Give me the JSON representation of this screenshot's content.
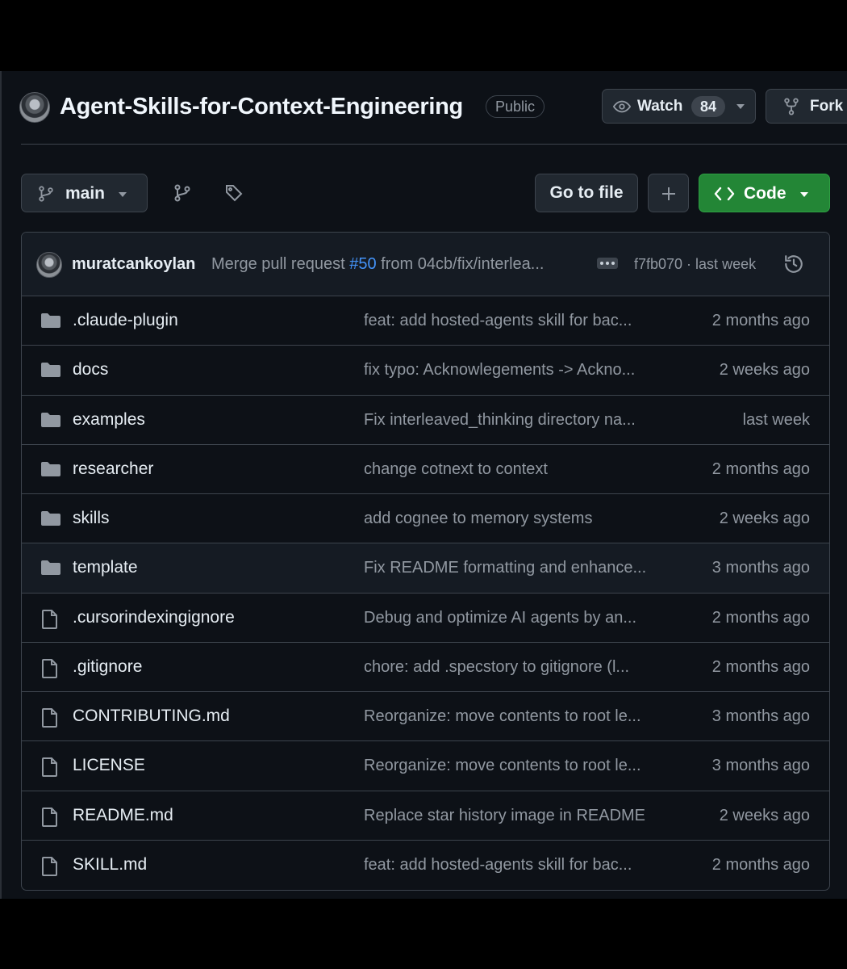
{
  "repo": {
    "name": "Agent-Skills-for-Context-Engineering",
    "visibility": "Public"
  },
  "actions": {
    "watch_label": "Watch",
    "watch_count": "84",
    "fork_label": "Fork"
  },
  "toolbar": {
    "branch": "main",
    "goto_file": "Go to file",
    "code_label": "Code"
  },
  "latest_commit": {
    "author": "muratcankoylan",
    "message_prefix": "Merge pull request ",
    "pr": "#50",
    "message_suffix": " from 04cb/fix/interlea...",
    "meta": "f7fb070 · last week"
  },
  "files": [
    {
      "type": "folder",
      "name": ".claude-plugin",
      "message": "feat: add hosted-agents skill for bac...",
      "date": "2 months ago"
    },
    {
      "type": "folder",
      "name": "docs",
      "message": "fix typo: Acknowlegements -> Ackno...",
      "date": "2 weeks ago"
    },
    {
      "type": "folder",
      "name": "examples",
      "message": "Fix interleaved_thinking directory na...",
      "date": "last week"
    },
    {
      "type": "folder",
      "name": "researcher",
      "message": "change cotnext to context",
      "date": "2 months ago"
    },
    {
      "type": "folder",
      "name": "skills",
      "message": "add cognee to memory systems",
      "date": "2 weeks ago"
    },
    {
      "type": "folder",
      "name": "template",
      "message": "Fix README formatting and enhance...",
      "date": "3 months ago"
    },
    {
      "type": "file",
      "name": ".cursorindexingignore",
      "message": "Debug and optimize AI agents by an...",
      "date": "2 months ago"
    },
    {
      "type": "file",
      "name": ".gitignore",
      "message": "chore: add .specstory to gitignore (l...",
      "date": "2 months ago"
    },
    {
      "type": "file",
      "name": "CONTRIBUTING.md",
      "message": "Reorganize: move contents to root le...",
      "date": "3 months ago"
    },
    {
      "type": "file",
      "name": "LICENSE",
      "message": "Reorganize: move contents to root le...",
      "date": "3 months ago"
    },
    {
      "type": "file",
      "name": "README.md",
      "message": "Replace star history image in README",
      "date": "2 weeks ago"
    },
    {
      "type": "file",
      "name": "SKILL.md",
      "message": "feat: add hosted-agents skill for bac...",
      "date": "2 months ago"
    }
  ],
  "colors": {
    "background": "#0d1117",
    "panel": "#151b23",
    "border": "#3d444d",
    "accent_green": "#238636",
    "link_blue": "#4493f8",
    "muted_text": "#9198a1"
  }
}
